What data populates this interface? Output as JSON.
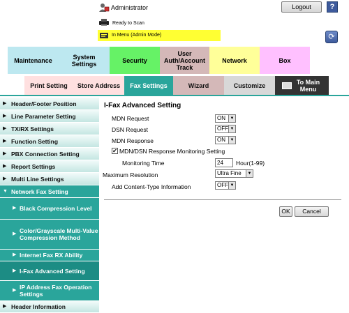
{
  "header": {
    "user_label": "Administrator",
    "logout_label": "Logout",
    "help_label": "?",
    "status": "Ready to Scan",
    "mode": "In Menu (Admin Mode)"
  },
  "main_tabs": [
    {
      "label": "Maintenance",
      "color": "#bde8f0"
    },
    {
      "label": "System Settings",
      "color": "#bde8f0"
    },
    {
      "label": "Security",
      "color": "#66f266"
    },
    {
      "label": "User Auth/Account Track",
      "color": "#d4b8b8"
    },
    {
      "label": "Network",
      "color": "#ffff99"
    },
    {
      "label": "Box",
      "color": "#ffc0ff"
    }
  ],
  "sub_tabs": [
    {
      "label": "Print Setting",
      "color": "#ffe0e0"
    },
    {
      "label": "Store Address",
      "color": "#ffe0e0"
    },
    {
      "label": "Fax Settings",
      "color": "#2aa59b"
    },
    {
      "label": "Wizard",
      "color": "#d4b8b8"
    },
    {
      "label": "Customize",
      "color": "#d8d8d8"
    },
    {
      "label": "To Main Menu",
      "color": "#333333"
    }
  ],
  "sidebar": {
    "items": [
      {
        "label": "Header/Footer Position"
      },
      {
        "label": "Line Parameter Setting"
      },
      {
        "label": "TX/RX Settings"
      },
      {
        "label": "Function Setting"
      },
      {
        "label": "PBX Connection Setting"
      },
      {
        "label": "Report Settings"
      },
      {
        "label": "Multi Line Settings"
      },
      {
        "label": "Network Fax Setting"
      },
      {
        "label": "Black Compression Level"
      },
      {
        "label": "Color/Grayscale Multi-Value Compression Method"
      },
      {
        "label": "Internet Fax RX Ability"
      },
      {
        "label": "I-Fax Advanced Setting"
      },
      {
        "label": "IP Address Fax Operation Settings"
      },
      {
        "label": "Header Information"
      }
    ]
  },
  "content": {
    "title": "I-Fax Advanced Setting",
    "mdn_request_label": "MDN Request",
    "mdn_request_value": "ON",
    "dsn_request_label": "DSN Request",
    "dsn_request_value": "OFF",
    "mdn_response_label": "MDN Response",
    "mdn_response_value": "ON",
    "monitoring_checkbox_label": "MDN/DSN Response Monitoring Setting",
    "monitoring_time_label": "Monitoring Time",
    "monitoring_time_value": "24",
    "monitoring_time_unit": "Hour(1-99)",
    "max_resolution_label": "Maximum Resolution",
    "max_resolution_value": "Ultra Fine",
    "content_type_label": "Add Content-Type Information",
    "content_type_value": "OFF",
    "ok_label": "OK",
    "cancel_label": "Cancel"
  }
}
